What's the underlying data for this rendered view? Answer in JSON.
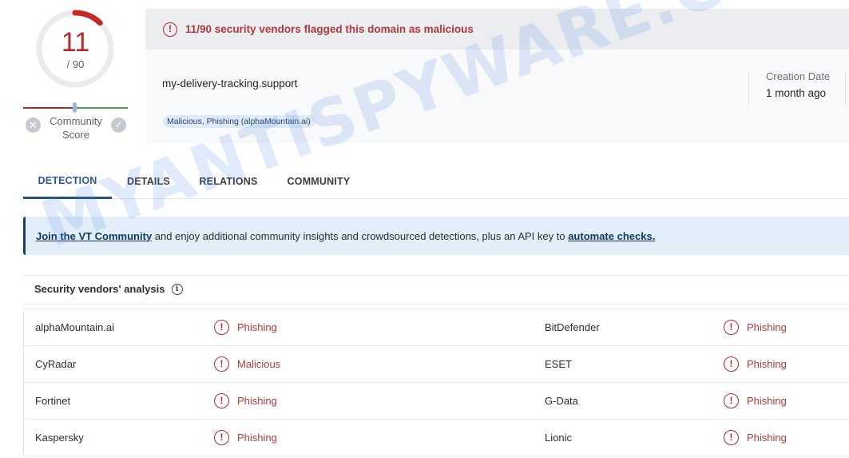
{
  "score": {
    "detections": "11",
    "total": "/ 90",
    "detection_fraction": 0.1222,
    "community_score_label": "Community Score",
    "community_label_line1": "Community",
    "community_label_line2": "Score",
    "community_position": 0.49
  },
  "header": {
    "alert_text": "11/90 security vendors flagged this domain as malicious",
    "domain": "my-delivery-tracking.support",
    "tag": "Malicious, Phishing (alphaMountain.ai)",
    "creation_date_label": "Creation Date",
    "creation_date_value": "1 month ago"
  },
  "tabs": [
    {
      "label": "DETECTION",
      "active": true
    },
    {
      "label": "DETAILS",
      "active": false
    },
    {
      "label": "RELATIONS",
      "active": false
    },
    {
      "label": "COMMUNITY",
      "active": false
    }
  ],
  "banner": {
    "link1": "Join the VT Community",
    "text": " and enjoy additional community insights and crowdsourced detections, plus an API key to ",
    "link2": "automate checks."
  },
  "vendors": {
    "title": "Security vendors' analysis",
    "rows": [
      {
        "vendor_left": "alphaMountain.ai",
        "result_left": "Phishing",
        "vendor_right": "BitDefender",
        "result_right": "Phishing"
      },
      {
        "vendor_left": "CyRadar",
        "result_left": "Malicious",
        "vendor_right": "ESET",
        "result_right": "Phishing"
      },
      {
        "vendor_left": "Fortinet",
        "result_left": "Phishing",
        "vendor_right": "G-Data",
        "result_right": "Phishing"
      },
      {
        "vendor_left": "Kaspersky",
        "result_left": "Phishing",
        "vendor_right": "Lionic",
        "result_right": "Phishing"
      }
    ]
  },
  "colors": {
    "malicious_red": "#b5282c",
    "accent_blue": "#24518a",
    "banner_bg": "#e2effb"
  },
  "watermark": "MYANTISPYWARE.COM"
}
